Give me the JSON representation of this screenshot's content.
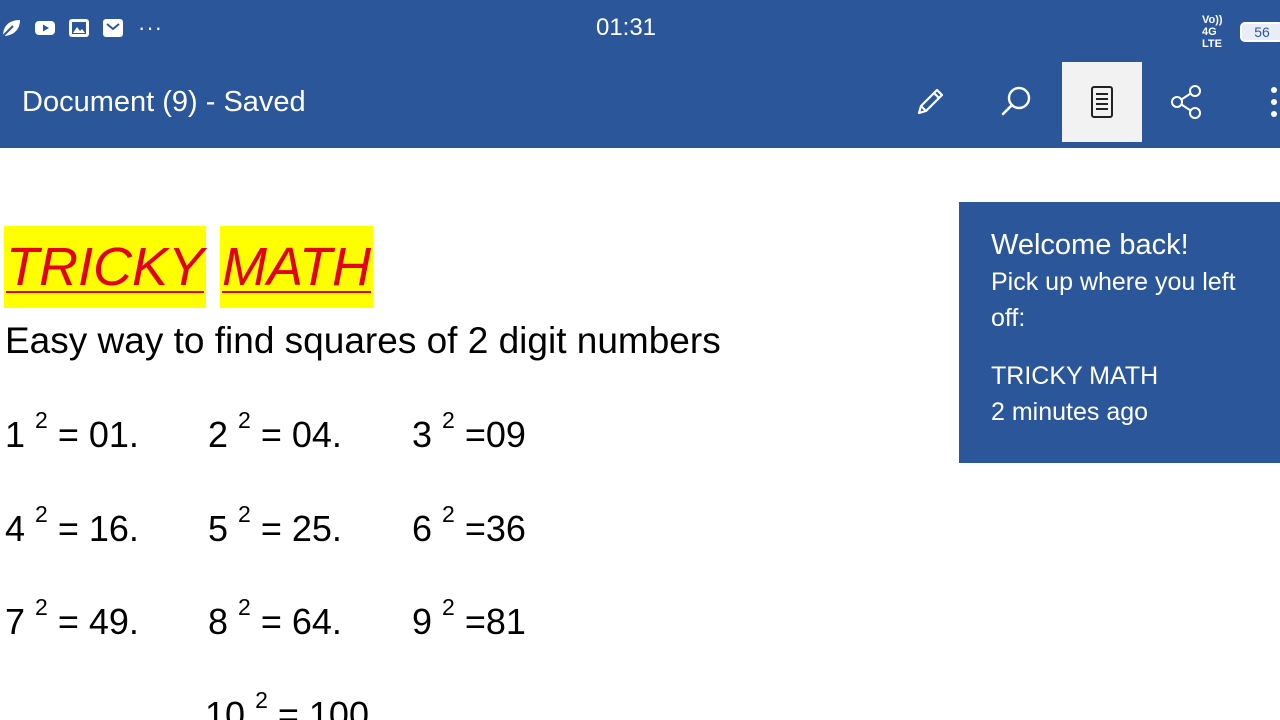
{
  "status_bar": {
    "time": "01:31",
    "network": "Vo)) 4G LTE",
    "battery": "56",
    "more_icons": "···"
  },
  "app_bar": {
    "title": "Document (9) - Saved",
    "buttons": {
      "edit": "pencil-icon",
      "search": "search-icon",
      "reading_view": "reading-view-icon",
      "share": "share-icon",
      "more": "more-vertical-icon"
    }
  },
  "document": {
    "heading_words": [
      "TRICKY",
      "MATH"
    ],
    "subtitle": "Easy way to find squares of 2 digit numbers",
    "squares": [
      {
        "base": "1",
        "exp": "2",
        "result": "= 01."
      },
      {
        "base": "2",
        "exp": "2",
        "result": "= 04."
      },
      {
        "base": "3",
        "exp": "2",
        "result": "=09"
      },
      {
        "base": "4",
        "exp": "2",
        "result": "= 16."
      },
      {
        "base": "5",
        "exp": "2",
        "result": "= 25."
      },
      {
        "base": "6",
        "exp": "2",
        "result": "=36"
      },
      {
        "base": "7",
        "exp": "2",
        "result": "= 49."
      },
      {
        "base": "8",
        "exp": "2",
        "result": "= 64."
      },
      {
        "base": "9",
        "exp": "2",
        "result": "=81"
      },
      {
        "base": "10",
        "exp": "2",
        "result": "= 100"
      }
    ]
  },
  "welcome_panel": {
    "title": "Welcome back!",
    "message": "Pick up where you left off:",
    "doc_name": "TRICKY MATH",
    "time_ago": "2 minutes ago"
  },
  "colors": {
    "brand": "#2b579a",
    "highlight": "#ffff00",
    "heading_text": "#e3001b"
  }
}
